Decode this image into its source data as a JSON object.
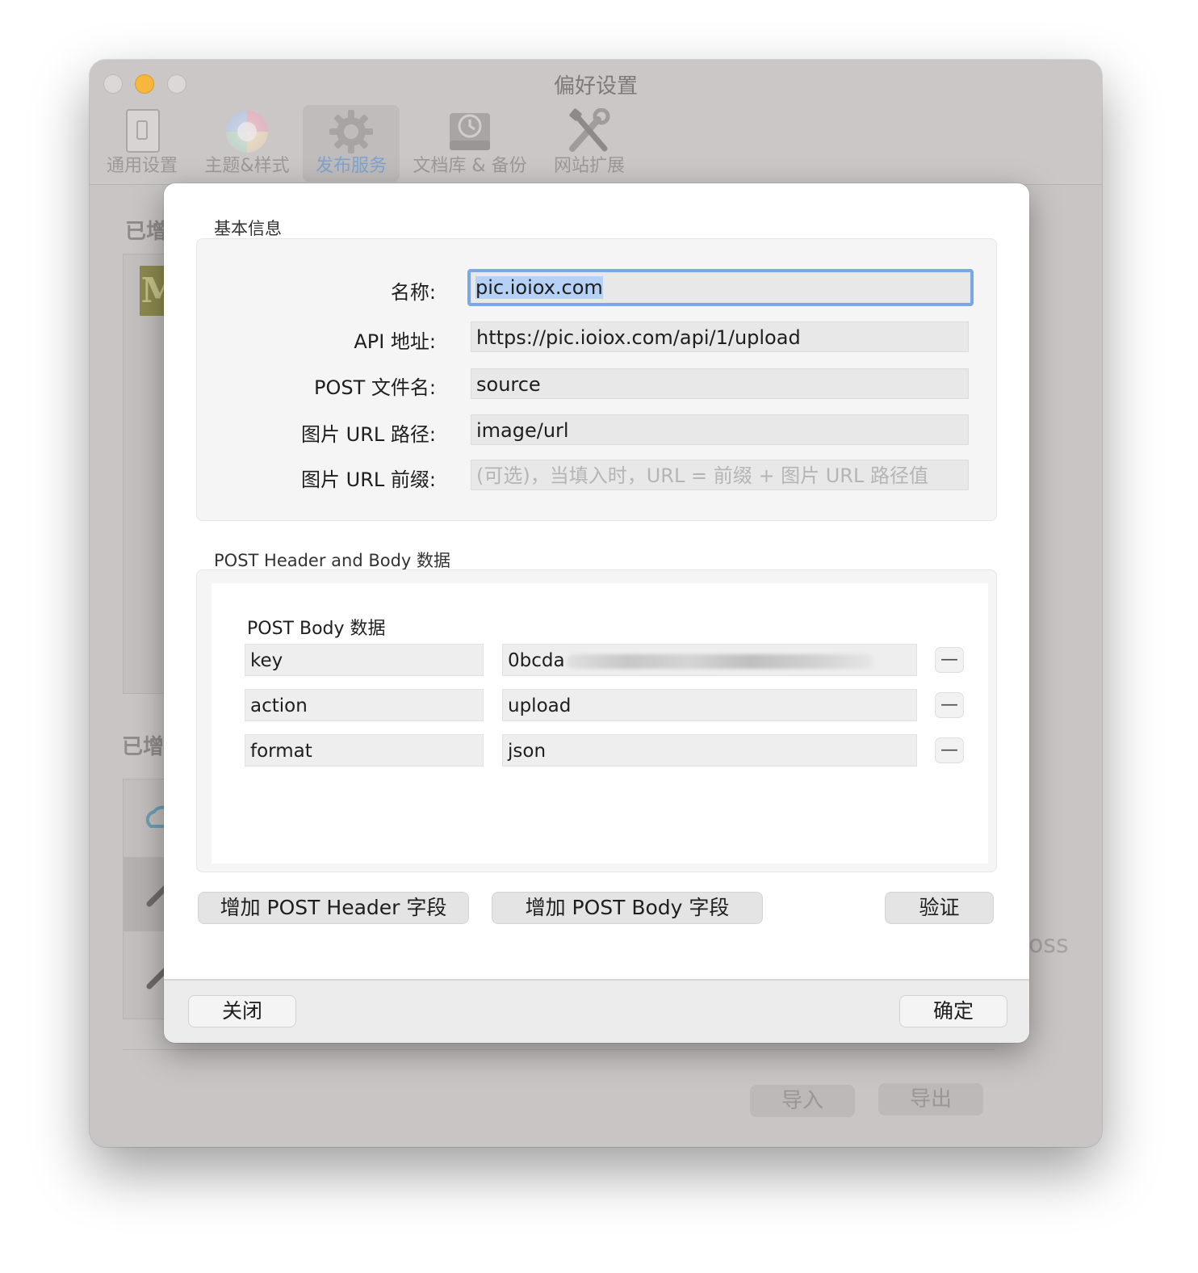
{
  "window": {
    "title": "偏好设置",
    "toolbar": [
      {
        "label": "通用设置",
        "icon": "phone-icon"
      },
      {
        "label": "主题&样式",
        "icon": "color-wheel-icon"
      },
      {
        "label": "发布服务",
        "icon": "gear-icon",
        "active": true
      },
      {
        "label": "文档库 & 备份",
        "icon": "time-machine-icon"
      },
      {
        "label": "网站扩展",
        "icon": "tools-icon"
      }
    ],
    "background": {
      "section1_label": "已增",
      "section2_label": "已增",
      "badge_letter": "M",
      "oss_fragment": "oss",
      "import_button": "导入",
      "export_button": "导出"
    }
  },
  "sheet": {
    "basic_section_title": "基本信息",
    "fields": [
      {
        "label": "名称:",
        "value": "pic.ioiox.com",
        "focused": true
      },
      {
        "label": "API 地址:",
        "value": "https://pic.ioiox.com/api/1/upload"
      },
      {
        "label": "POST 文件名:",
        "value": "source"
      },
      {
        "label": "图片 URL 路径:",
        "value": "image/url"
      },
      {
        "label": "图片 URL 前缀:",
        "placeholder": "(可选)，当填入时，URL = 前缀 + 图片 URL 路径值"
      }
    ],
    "post_section_title": "POST Header and Body 数据",
    "body_title": "POST Body 数据",
    "body_rows": [
      {
        "key": "key",
        "value": "0bcda"
      },
      {
        "key": "action",
        "value": "upload"
      },
      {
        "key": "format",
        "value": "json"
      }
    ],
    "remove_label": "—",
    "add_header_button": "增加 POST Header 字段",
    "add_body_button": "增加 POST Body 字段",
    "verify_button": "验证",
    "close_button": "关闭",
    "ok_button": "确定"
  },
  "colors": {
    "focus_ring": "#7aa7e6",
    "active_tab_text": "#7fa3cd",
    "minimize_light": "#f6b73c"
  }
}
